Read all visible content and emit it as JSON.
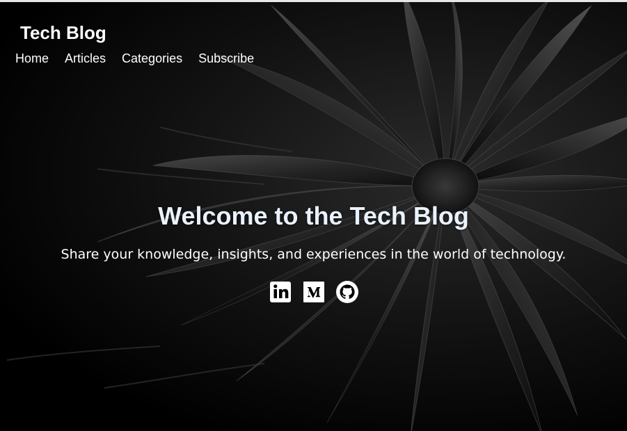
{
  "header": {
    "site_title": "Tech Blog",
    "nav": [
      {
        "label": "Home"
      },
      {
        "label": "Articles"
      },
      {
        "label": "Categories"
      },
      {
        "label": "Subscribe"
      }
    ]
  },
  "hero": {
    "headline": "Welcome to the Tech Blog",
    "tagline": "Share your knowledge, insights, and experiences in the world of technology.",
    "socials": [
      {
        "icon": "linkedin-icon"
      },
      {
        "icon": "medium-icon"
      },
      {
        "icon": "github-icon"
      }
    ]
  },
  "colors": {
    "background": "#000000",
    "text": "#ffffff",
    "headline": "#eaf2ff",
    "top_border": "#e8e8e8"
  }
}
